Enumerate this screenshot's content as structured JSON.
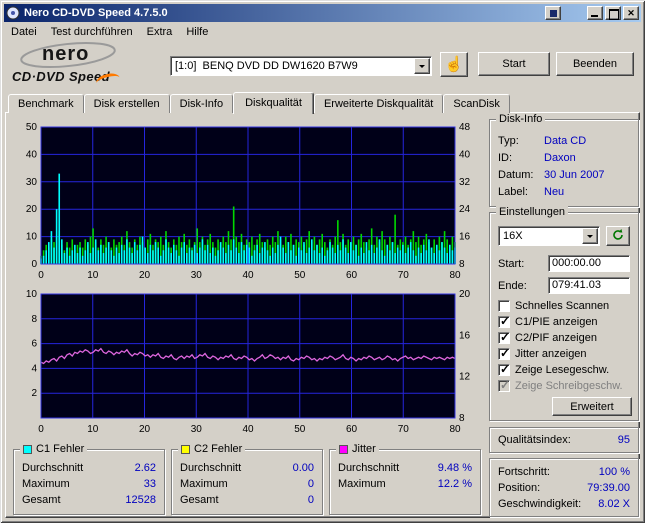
{
  "window": {
    "title": "Nero CD-DVD Speed 4.7.5.0"
  },
  "menu": {
    "items": [
      "Datei",
      "Test durchführen",
      "Extra",
      "Hilfe"
    ]
  },
  "toolbar": {
    "logo_brand": "nero",
    "logo_product": "CD·DVD Speed",
    "drive_value": "[1:0]  BENQ DVD DD DW1620 B7W9",
    "start_label": "Start",
    "quit_label": "Beenden"
  },
  "tabs": {
    "items": [
      "Benchmark",
      "Disk erstellen",
      "Disk-Info",
      "Diskqualität",
      "Erweiterte Diskqualität",
      "ScanDisk"
    ],
    "active": "Diskqualität"
  },
  "disk_info": {
    "title": "Disk-Info",
    "rows": [
      {
        "label": "Typ:",
        "value": "Data CD"
      },
      {
        "label": "ID:",
        "value": "Daxon"
      },
      {
        "label": "Datum:",
        "value": "30 Jun 2007"
      },
      {
        "label": "Label:",
        "value": "Neu"
      }
    ]
  },
  "settings": {
    "title": "Einstellungen",
    "speed_value": "16X",
    "start_label": "Start:",
    "start_value": "000:00.00",
    "end_label": "Ende:",
    "end_value": "079:41.03",
    "checkboxes": [
      {
        "label": "Schnelles Scannen",
        "checked": false,
        "disabled": false
      },
      {
        "label": "C1/PIE anzeigen",
        "checked": true,
        "disabled": false
      },
      {
        "label": "C2/PIF anzeigen",
        "checked": true,
        "disabled": false
      },
      {
        "label": "Jitter anzeigen",
        "checked": true,
        "disabled": false
      },
      {
        "label": "Zeige Lesegeschw.",
        "checked": true,
        "disabled": false
      },
      {
        "label": "Zeige Schreibgeschw.",
        "checked": true,
        "disabled": true
      }
    ],
    "advanced_label": "Erweitert"
  },
  "quality": {
    "label": "Qualitätsindex:",
    "value": "95"
  },
  "progress": {
    "rows": [
      {
        "label": "Fortschritt:",
        "value": "100 %"
      },
      {
        "label": "Position:",
        "value": "79:39.00"
      },
      {
        "label": "Geschwindigkeit:",
        "value": "8.02 X"
      }
    ]
  },
  "legends": [
    {
      "title": "C1 Fehler",
      "color": "#00ffff",
      "rows": [
        [
          "Durchschnitt",
          "2.62"
        ],
        [
          "Maximum",
          "33"
        ],
        [
          "Gesamt",
          "12528"
        ]
      ]
    },
    {
      "title": "C2 Fehler",
      "color": "#ffff00",
      "rows": [
        [
          "Durchschnitt",
          "0.00"
        ],
        [
          "Maximum",
          "0"
        ],
        [
          "Gesamt",
          "0"
        ]
      ]
    },
    {
      "title": "Jitter",
      "color": "#ff00ff",
      "rows": [
        [
          "Durchschnitt",
          "9.48 %"
        ],
        [
          "Maximum",
          "12.2 %"
        ]
      ]
    }
  ],
  "colors": {
    "value_text": "#0000bf",
    "titlebar_left": "#0a246a",
    "titlebar_right": "#a6caf0",
    "c1_color": "#00ffff",
    "c1_overlay_color": "#00d800",
    "jitter_color": "#dd66dd"
  },
  "chart_data": [
    {
      "type": "bar",
      "title": "C1 Fehler",
      "x_range": [
        0,
        80
      ],
      "x_ticks": [
        0,
        10,
        20,
        30,
        40,
        50,
        60,
        70,
        80
      ],
      "left_axis": {
        "range": [
          0,
          50
        ],
        "ticks": [
          0,
          10,
          20,
          30,
          40,
          50
        ]
      },
      "right_axis": {
        "range": [
          8,
          48
        ],
        "ticks": [
          8,
          16,
          24,
          32,
          40,
          48
        ]
      },
      "bg": "#000018",
      "grid": "#2525dd",
      "border": "#3535e5",
      "series": [
        {
          "name": "c1-overlay-green",
          "color": "#00d800",
          "style": "spikes",
          "axis": "left",
          "values": [
            3,
            5,
            7,
            6,
            9,
            8,
            10,
            12,
            7,
            5,
            8,
            6,
            9,
            5,
            7,
            8,
            6,
            9,
            7,
            10,
            13,
            8,
            6,
            9,
            7,
            10,
            8,
            6,
            9,
            7,
            8,
            10,
            7,
            12,
            8,
            6,
            9,
            7,
            10,
            8,
            6,
            9,
            11,
            7,
            9,
            8,
            10,
            7,
            12,
            8,
            6,
            9,
            7,
            10,
            8,
            11,
            7,
            9,
            6,
            8,
            13,
            8,
            10,
            7,
            9,
            11,
            8,
            6,
            9,
            7,
            10,
            8,
            12,
            9,
            21,
            10,
            8,
            11,
            7,
            9,
            8,
            10,
            7,
            9,
            11,
            8,
            6,
            9,
            7,
            10,
            8,
            12,
            9,
            7,
            10,
            8,
            11,
            7,
            9,
            8,
            10,
            7,
            9,
            12,
            8,
            10,
            7,
            9,
            11,
            8,
            6,
            9,
            7,
            10,
            16,
            8,
            11,
            7,
            9,
            8,
            10,
            7,
            9,
            11,
            8,
            6,
            9,
            13,
            7,
            10,
            8,
            12,
            9,
            7,
            10,
            8,
            18,
            7,
            9,
            8,
            10,
            7,
            9,
            12,
            8,
            10,
            7,
            9,
            11,
            8,
            6,
            9,
            7,
            10,
            8,
            12,
            9,
            7,
            10,
            8
          ]
        },
        {
          "name": "c1-fehler",
          "color": "#00ffff",
          "style": "spikes",
          "axis": "left",
          "values": [
            2,
            3,
            5,
            8,
            12,
            6,
            20,
            33,
            9,
            4,
            6,
            3,
            5,
            7,
            4,
            6,
            3,
            5,
            8,
            4,
            6,
            9,
            5,
            7,
            4,
            6,
            8,
            5,
            3,
            6,
            4,
            7,
            5,
            9,
            6,
            4,
            8,
            5,
            7,
            10,
            6,
            4,
            7,
            5,
            8,
            6,
            3,
            5,
            9,
            6,
            4,
            7,
            5,
            3,
            6,
            8,
            4,
            6,
            5,
            7,
            4,
            6,
            9,
            5,
            7,
            4,
            6,
            3,
            5,
            8,
            6,
            4,
            7,
            5,
            9,
            6,
            4,
            8,
            5,
            7,
            6,
            3,
            5,
            7,
            4,
            6,
            8,
            5,
            3,
            6,
            4,
            7,
            10,
            6,
            4,
            8,
            5,
            7,
            3,
            6,
            5,
            8,
            4,
            6,
            9,
            5,
            7,
            4,
            6,
            3,
            5,
            8,
            6,
            4,
            7,
            5,
            9,
            6,
            4,
            8,
            5,
            7,
            3,
            6,
            4,
            8,
            5,
            7,
            4,
            6,
            9,
            5,
            3,
            7,
            5,
            8,
            4,
            6,
            5,
            7,
            4,
            6,
            8,
            5,
            3,
            6,
            4,
            7,
            5,
            9,
            6,
            4,
            7,
            5,
            8,
            6,
            4,
            7,
            5,
            6
          ]
        }
      ]
    },
    {
      "type": "line",
      "title": "Jitter",
      "x_range": [
        0,
        80
      ],
      "x_ticks": [
        0,
        10,
        20,
        30,
        40,
        50,
        60,
        70,
        80
      ],
      "left_axis": {
        "range": [
          0,
          10
        ],
        "ticks": [
          2,
          4,
          6,
          8,
          10
        ]
      },
      "right_axis": {
        "range": [
          8,
          20
        ],
        "ticks": [
          8,
          12,
          16,
          20
        ]
      },
      "bg": "#000018",
      "grid": "#2525dd",
      "border": "#3535e5",
      "series": [
        {
          "name": "jitter",
          "color": "#dd66dd",
          "style": "line",
          "axis": "left",
          "values": [
            4.5,
            4.4,
            4.6,
            4.5,
            4.7,
            4.8,
            4.6,
            4.9,
            5.0,
            4.8,
            5.1,
            5.2,
            5.0,
            5.3,
            5.2,
            5.4,
            5.3,
            5.5,
            5.4,
            5.2,
            5.3,
            5.5,
            5.4,
            5.6,
            5.3,
            5.2,
            5.4,
            5.3,
            5.1,
            5.3,
            5.2,
            5.4,
            5.3,
            5.5,
            5.2,
            5.0,
            5.2,
            5.1,
            5.3,
            5.2,
            5.0,
            5.1,
            4.9,
            5.1,
            5.0,
            5.2,
            4.9,
            4.8,
            5.0,
            4.9,
            5.1,
            4.8,
            4.7,
            4.9,
            5.0,
            4.8,
            5.0,
            4.9,
            5.1,
            4.8,
            4.9,
            5.1,
            5.0,
            5.2,
            4.9,
            4.8,
            5.0,
            4.9,
            4.7,
            4.9,
            4.8,
            5.0,
            4.9,
            5.1,
            4.8,
            4.7,
            4.9,
            4.8,
            5.0,
            4.9,
            4.7,
            4.8,
            4.6,
            4.8,
            4.9,
            5.1,
            4.8,
            4.9,
            5.1,
            5.0,
            4.8,
            4.9,
            4.7,
            4.9,
            4.8,
            5.0,
            4.7,
            4.6,
            4.8,
            4.7,
            4.9,
            4.8,
            5.0,
            4.9,
            4.7,
            4.8,
            4.6,
            4.8,
            4.7,
            4.9,
            4.8,
            5.0,
            4.9,
            4.7,
            4.8,
            4.9,
            5.1,
            4.8,
            4.7,
            4.9,
            4.8,
            4.6,
            4.8,
            4.7,
            4.9,
            4.8,
            5.0,
            4.9,
            4.7,
            4.8,
            4.9,
            4.7,
            4.8,
            5.0,
            4.9,
            4.7,
            4.8,
            4.6,
            4.8,
            4.9,
            5.0,
            4.8,
            4.9,
            4.7,
            4.8,
            4.9,
            4.8,
            5.0,
            4.9,
            4.8,
            4.7,
            4.9,
            4.8,
            4.9,
            4.8,
            4.7,
            4.9,
            4.8,
            4.9,
            4.8
          ]
        }
      ]
    }
  ]
}
